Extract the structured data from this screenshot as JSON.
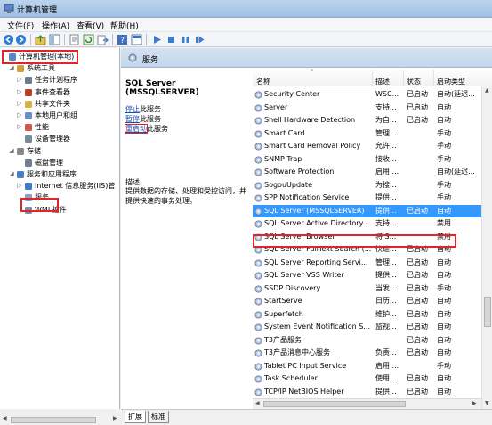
{
  "window": {
    "title": "计算机管理"
  },
  "menu": [
    "文件(F)",
    "操作(A)",
    "查看(V)",
    "帮助(H)"
  ],
  "tree": [
    {
      "label": "计算机管理(本地)",
      "icon": "computer-management-icon",
      "indent": 0,
      "expander": ""
    },
    {
      "label": "系统工具",
      "icon": "tools-icon",
      "indent": 1,
      "expander": "◢"
    },
    {
      "label": "任务计划程序",
      "icon": "clock-icon",
      "indent": 2,
      "expander": "▷"
    },
    {
      "label": "事件查看器",
      "icon": "event-viewer-icon",
      "indent": 2,
      "expander": "▷"
    },
    {
      "label": "共享文件夹",
      "icon": "shared-folder-icon",
      "indent": 2,
      "expander": "▷"
    },
    {
      "label": "本地用户和组",
      "icon": "users-icon",
      "indent": 2,
      "expander": "▷"
    },
    {
      "label": "性能",
      "icon": "performance-icon",
      "indent": 2,
      "expander": "▷"
    },
    {
      "label": "设备管理器",
      "icon": "device-manager-icon",
      "indent": 2,
      "expander": ""
    },
    {
      "label": "存储",
      "icon": "storage-icon",
      "indent": 1,
      "expander": "◢"
    },
    {
      "label": "磁盘管理",
      "icon": "disk-icon",
      "indent": 2,
      "expander": ""
    },
    {
      "label": "服务和应用程序",
      "icon": "services-apps-icon",
      "indent": 1,
      "expander": "◢"
    },
    {
      "label": "Internet 信息服务(IIS)管",
      "icon": "iis-icon",
      "indent": 2,
      "expander": "▷"
    },
    {
      "label": "服务",
      "icon": "services-icon",
      "indent": 2,
      "expander": ""
    },
    {
      "label": "WMI 控件",
      "icon": "wmi-icon",
      "indent": 2,
      "expander": ""
    }
  ],
  "right_header": {
    "title": "服务"
  },
  "desc": {
    "title": "SQL Server (MSSQLSERVER)",
    "stop_link": "停止",
    "stop_suffix": "此服务",
    "pause_link": "暂停",
    "pause_suffix": "此服务",
    "restart_link": "重启动",
    "restart_suffix": "此服务",
    "label": "描述:",
    "text": "提供数据的存储、处理和受控访问，并提供快速的事务处理。"
  },
  "columns": {
    "name": "名称",
    "desc": "描述",
    "state": "状态",
    "start": "启动类型"
  },
  "services": [
    {
      "name": "Security Center",
      "desc": "WSC...",
      "state": "已启动",
      "start": "自动(延迟..."
    },
    {
      "name": "Server",
      "desc": "支持...",
      "state": "已启动",
      "start": "自动"
    },
    {
      "name": "Shell Hardware Detection",
      "desc": "为自...",
      "state": "已启动",
      "start": "自动"
    },
    {
      "name": "Smart Card",
      "desc": "管理...",
      "state": "",
      "start": "手动"
    },
    {
      "name": "Smart Card Removal Policy",
      "desc": "允许...",
      "state": "",
      "start": "手动"
    },
    {
      "name": "SNMP Trap",
      "desc": "接收...",
      "state": "",
      "start": "手动"
    },
    {
      "name": "Software Protection",
      "desc": "启用 ...",
      "state": "",
      "start": "自动(延迟..."
    },
    {
      "name": "SogouUpdate",
      "desc": "为搜...",
      "state": "",
      "start": "手动"
    },
    {
      "name": "SPP Notification Service",
      "desc": "提供...",
      "state": "",
      "start": "手动"
    },
    {
      "name": "SQL Server (MSSQLSERVER)",
      "desc": "提供...",
      "state": "已启动",
      "start": "自动"
    },
    {
      "name": "SQL Server Active Directory...",
      "desc": "支持...",
      "state": "",
      "start": "禁用"
    },
    {
      "name": "SQL Server Browser",
      "desc": "将 S...",
      "state": "",
      "start": "禁用"
    },
    {
      "name": "SQL Server FullText Search (...",
      "desc": "快速...",
      "state": "已启动",
      "start": "自动"
    },
    {
      "name": "SQL Server Reporting Servi...",
      "desc": "管理...",
      "state": "已启动",
      "start": "自动"
    },
    {
      "name": "SQL Server VSS Writer",
      "desc": "提供...",
      "state": "已启动",
      "start": "自动"
    },
    {
      "name": "SSDP Discovery",
      "desc": "当发...",
      "state": "已启动",
      "start": "手动"
    },
    {
      "name": "StartServe",
      "desc": "日历...",
      "state": "已启动",
      "start": "自动"
    },
    {
      "name": "Superfetch",
      "desc": "维护...",
      "state": "已启动",
      "start": "自动"
    },
    {
      "name": "System Event Notification S...",
      "desc": "监视...",
      "state": "已启动",
      "start": "自动"
    },
    {
      "name": "T3产品服务",
      "desc": "",
      "state": "已启动",
      "start": "自动"
    },
    {
      "name": "T3产品消息中心服务",
      "desc": "负责...",
      "state": "已启动",
      "start": "自动"
    },
    {
      "name": "Tablet PC Input Service",
      "desc": "启用 ...",
      "state": "",
      "start": "手动"
    },
    {
      "name": "Task Scheduler",
      "desc": "使用...",
      "state": "已启动",
      "start": "自动"
    },
    {
      "name": "TCP/IP NetBIOS Helper",
      "desc": "提供...",
      "state": "已启动",
      "start": "自动"
    }
  ],
  "selected_index": 9,
  "tabs": [
    "扩展",
    "标准"
  ]
}
